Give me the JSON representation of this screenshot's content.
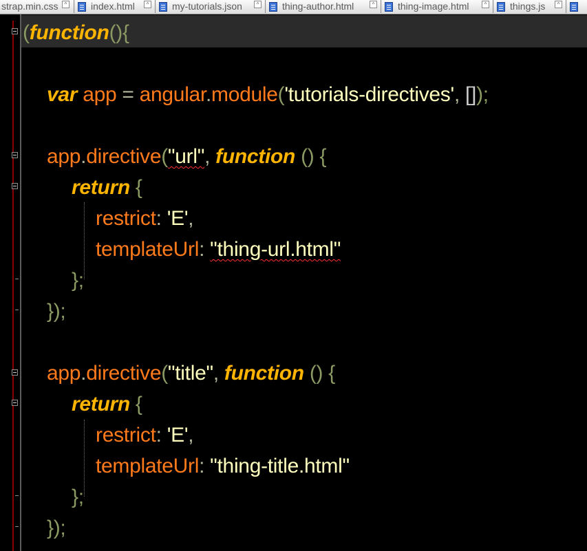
{
  "tabs": [
    {
      "label": "strap.min.css"
    },
    {
      "label": "index.html"
    },
    {
      "label": "my-tutorials.json"
    },
    {
      "label": "thing-author.html"
    },
    {
      "label": "thing-image.html"
    },
    {
      "label": "things.js"
    }
  ],
  "code": {
    "l1": {
      "a": "(",
      "b": "function",
      "c": "(){"
    },
    "l3": {
      "a": "var",
      "b": " app ",
      "c": "= ",
      "d": "angular",
      "e": ".",
      "f": "module",
      "g": "(",
      "h": "'tutorials-directives'",
      "i": ", ",
      "j": "[]",
      "k": ");"
    },
    "l5": {
      "a": "app",
      "b": ".",
      "c": "directive",
      "d": "(",
      "e": "\"url\"",
      "f": ", ",
      "g": "function",
      "h": " () {"
    },
    "l6": {
      "a": "return",
      "b": " {"
    },
    "l7": {
      "a": "restrict",
      "b": ": ",
      "c": "'E'",
      "d": ","
    },
    "l8": {
      "a": "templateUrl",
      "b": ": ",
      "c": "\"thing-url.html\""
    },
    "l9": {
      "a": "};"
    },
    "l10": {
      "a": "});"
    },
    "l12": {
      "a": "app",
      "b": ".",
      "c": "directive",
      "d": "(",
      "e": "\"title\"",
      "f": ", ",
      "g": "function",
      "h": " () {"
    },
    "l13": {
      "a": "return",
      "b": " {"
    },
    "l14": {
      "a": "restrict",
      "b": ": ",
      "c": "'E'",
      "d": ","
    },
    "l15": {
      "a": "templateUrl",
      "b": ": ",
      "c": "\"thing-title.html\""
    },
    "l16": {
      "a": "};"
    },
    "l17": {
      "a": "});"
    }
  }
}
